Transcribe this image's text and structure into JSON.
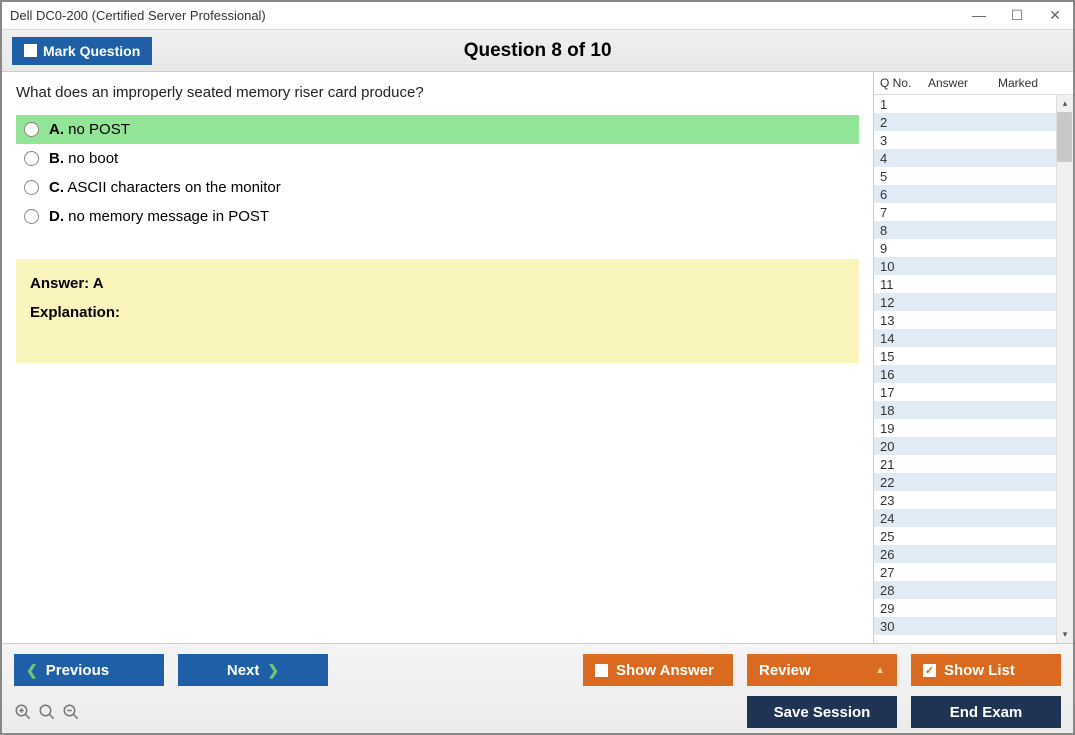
{
  "window": {
    "title": "Dell DC0-200 (Certified Server Professional)"
  },
  "header": {
    "mark_label": "Mark Question",
    "question_title": "Question 8 of 10"
  },
  "question": {
    "text": "What does an improperly seated memory riser card produce?",
    "options": [
      {
        "letter": "A.",
        "text": "no POST",
        "highlighted": true
      },
      {
        "letter": "B.",
        "text": "no boot",
        "highlighted": false
      },
      {
        "letter": "C.",
        "text": "ASCII characters on the monitor",
        "highlighted": false
      },
      {
        "letter": "D.",
        "text": "no memory message in POST",
        "highlighted": false
      }
    ],
    "answer_label": "Answer: A",
    "explanation_label": "Explanation:"
  },
  "sidebar": {
    "headers": {
      "qno": "Q No.",
      "answer": "Answer",
      "marked": "Marked"
    },
    "rows": [
      {
        "n": "1"
      },
      {
        "n": "2"
      },
      {
        "n": "3"
      },
      {
        "n": "4"
      },
      {
        "n": "5"
      },
      {
        "n": "6"
      },
      {
        "n": "7"
      },
      {
        "n": "8"
      },
      {
        "n": "9"
      },
      {
        "n": "10"
      },
      {
        "n": "11"
      },
      {
        "n": "12"
      },
      {
        "n": "13"
      },
      {
        "n": "14"
      },
      {
        "n": "15"
      },
      {
        "n": "16"
      },
      {
        "n": "17"
      },
      {
        "n": "18"
      },
      {
        "n": "19"
      },
      {
        "n": "20"
      },
      {
        "n": "21"
      },
      {
        "n": "22"
      },
      {
        "n": "23"
      },
      {
        "n": "24"
      },
      {
        "n": "25"
      },
      {
        "n": "26"
      },
      {
        "n": "27"
      },
      {
        "n": "28"
      },
      {
        "n": "29"
      },
      {
        "n": "30"
      }
    ]
  },
  "buttons": {
    "previous": "Previous",
    "next": "Next",
    "show_answer": "Show Answer",
    "review": "Review",
    "show_list": "Show List",
    "save_session": "Save Session",
    "end_exam": "End Exam"
  }
}
